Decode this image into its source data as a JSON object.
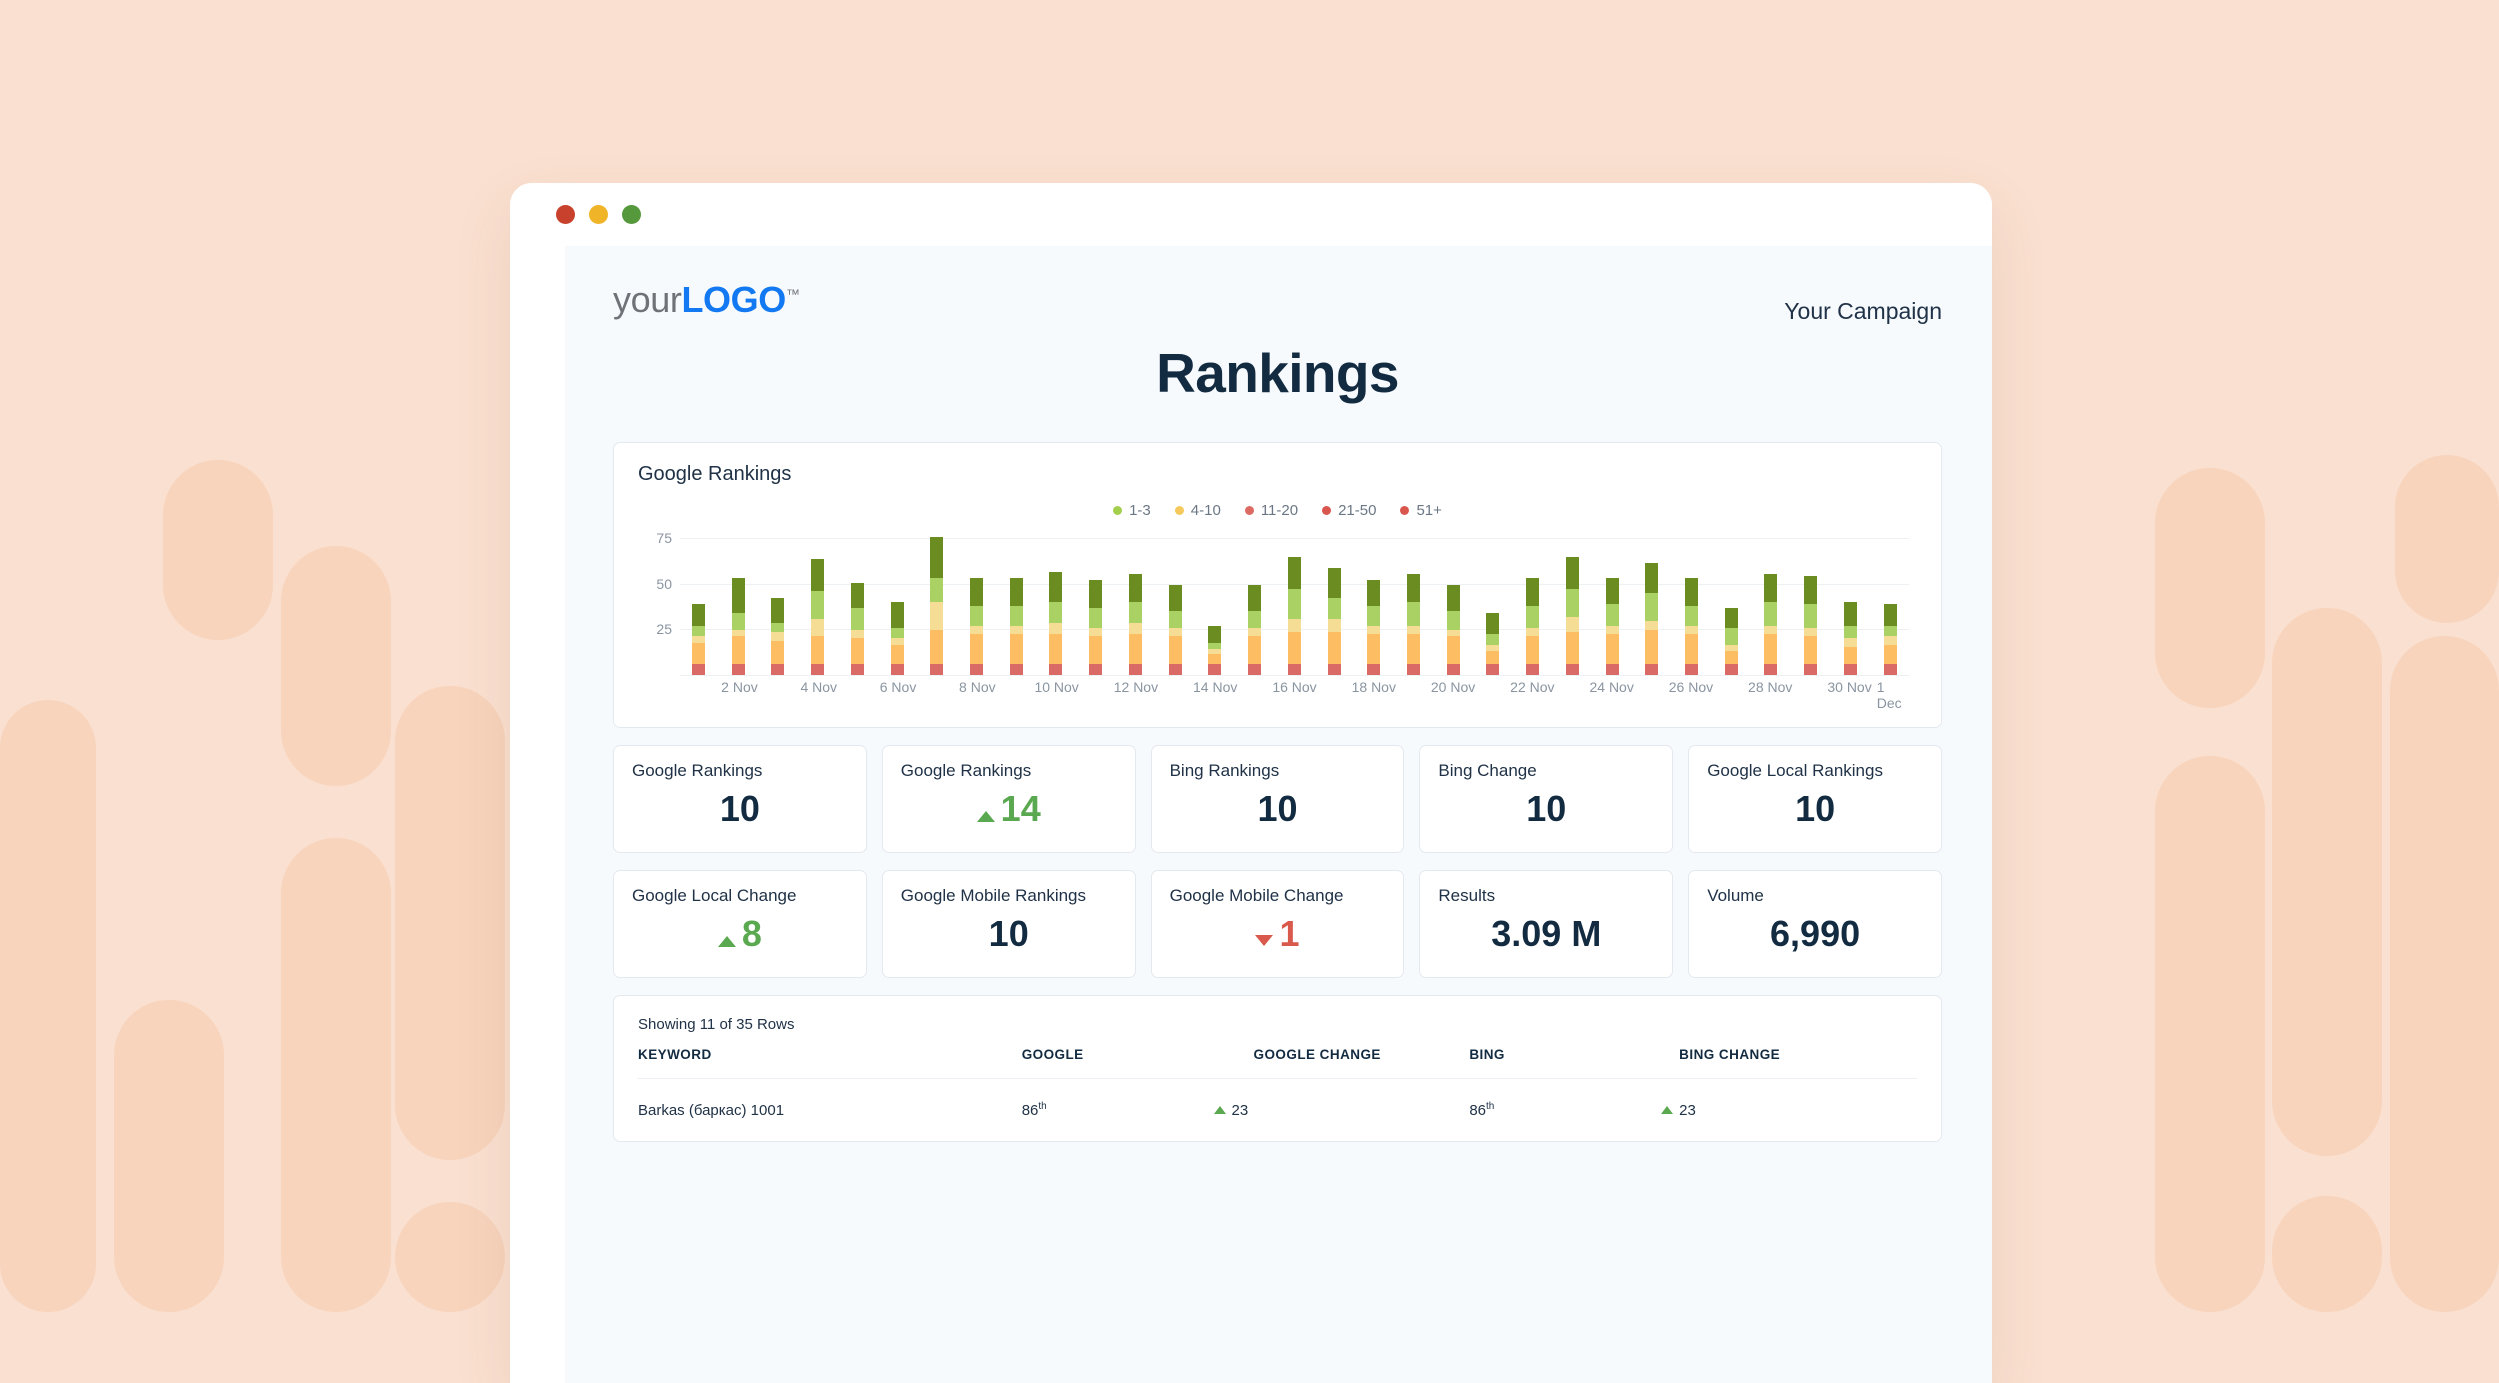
{
  "window": {
    "dots": [
      "close-red",
      "minimize-amber",
      "maximize-green"
    ]
  },
  "header": {
    "logo_prefix": "your",
    "logo_bold": "LOGO",
    "logo_tm": "™",
    "campaign": "Your Campaign",
    "title": "Rankings"
  },
  "chart_card": {
    "title": "Google Rankings"
  },
  "chart_data": {
    "type": "bar",
    "stacked": true,
    "title": "Google Rankings",
    "xlabel": "",
    "ylabel": "",
    "ylim": [
      0,
      80
    ],
    "yticks": [
      25,
      50,
      75
    ],
    "grid": true,
    "legend_position": "top-center",
    "legend": [
      "1-3",
      "4-10",
      "11-20",
      "21-50",
      "51+"
    ],
    "colors": {
      "1-3": "#6b8c21",
      "4-10": "#a9d163",
      "11-20": "#f5dd96",
      "21-50": "#fcbd63",
      "51+": "#da6a65"
    },
    "legend_dot_colors": {
      "1-3": "#a4cf4d",
      "4-10": "#f5c95b",
      "11-20": "#dd6a62",
      "21-50": "#d9564f",
      "51+": "#d9564f"
    },
    "x": [
      "1 Nov",
      "2 Nov",
      "3 Nov",
      "4 Nov",
      "5 Nov",
      "6 Nov",
      "7 Nov",
      "8 Nov",
      "9 Nov",
      "10 Nov",
      "11 Nov",
      "12 Nov",
      "13 Nov",
      "14 Nov",
      "15 Nov",
      "16 Nov",
      "17 Nov",
      "18 Nov",
      "19 Nov",
      "20 Nov",
      "21 Nov",
      "22 Nov",
      "23 Nov",
      "24 Nov",
      "25 Nov",
      "26 Nov",
      "27 Nov",
      "28 Nov",
      "29 Nov",
      "30 Nov",
      "1 Dec"
    ],
    "xticklabels": [
      "2 Nov",
      "4 Nov",
      "6 Nov",
      "8 Nov",
      "10 Nov",
      "12 Nov",
      "14 Nov",
      "16 Nov",
      "18 Nov",
      "20 Nov",
      "22 Nov",
      "24 Nov",
      "26 Nov",
      "28 Nov",
      "30 Nov",
      "1 Dec"
    ],
    "series": [
      {
        "name": "51+",
        "values": [
          5,
          5,
          5,
          5,
          5,
          5,
          5,
          5,
          5,
          5,
          5,
          5,
          5,
          5,
          5,
          5,
          5,
          5,
          5,
          5,
          5,
          5,
          5,
          5,
          5,
          5,
          5,
          5,
          5,
          5,
          5
        ]
      },
      {
        "name": "21-50",
        "values": [
          10,
          13,
          11,
          13,
          12,
          9,
          16,
          14,
          14,
          14,
          13,
          14,
          13,
          5,
          13,
          15,
          15,
          14,
          14,
          13,
          6,
          13,
          15,
          14,
          16,
          14,
          6,
          14,
          13,
          8,
          9
        ]
      },
      {
        "name": "11-20",
        "values": [
          3,
          3,
          4,
          8,
          4,
          3,
          13,
          4,
          4,
          5,
          4,
          5,
          4,
          2,
          4,
          6,
          6,
          4,
          4,
          3,
          3,
          4,
          7,
          4,
          4,
          4,
          3,
          4,
          4,
          4,
          4
        ]
      },
      {
        "name": "4-10",
        "values": [
          5,
          8,
          4,
          13,
          10,
          5,
          11,
          9,
          9,
          10,
          9,
          10,
          8,
          3,
          8,
          14,
          10,
          9,
          11,
          9,
          5,
          10,
          13,
          10,
          13,
          9,
          8,
          11,
          11,
          6,
          5
        ]
      },
      {
        "name": "1-3",
        "values": [
          10,
          16,
          12,
          15,
          12,
          12,
          19,
          13,
          13,
          14,
          13,
          13,
          12,
          8,
          12,
          15,
          14,
          12,
          13,
          12,
          10,
          13,
          15,
          12,
          14,
          13,
          9,
          13,
          13,
          11,
          10
        ]
      }
    ]
  },
  "kpi_rows": [
    [
      {
        "label": "Google Rankings",
        "value": "10",
        "trend": "none"
      },
      {
        "label": "Google Rankings",
        "value": "14",
        "trend": "up"
      },
      {
        "label": "Bing Rankings",
        "value": "10",
        "trend": "none"
      },
      {
        "label": "Bing Change",
        "value": "10",
        "trend": "none"
      },
      {
        "label": "Google Local Rankings",
        "value": "10",
        "trend": "none"
      }
    ],
    [
      {
        "label": "Google Local Change",
        "value": "8",
        "trend": "up"
      },
      {
        "label": "Google Mobile Rankings",
        "value": "10",
        "trend": "none"
      },
      {
        "label": "Google Mobile Change",
        "value": "1",
        "trend": "down"
      },
      {
        "label": "Results",
        "value": "3.09 M",
        "trend": "none"
      },
      {
        "label": "Volume",
        "value": "6,990",
        "trend": "none"
      }
    ]
  ],
  "table": {
    "rows_note": "Showing 11 of 35 Rows",
    "columns": [
      "KEYWORD",
      "GOOGLE",
      "GOOGLE CHANGE",
      "BING",
      "BING CHANGE"
    ],
    "rows": [
      {
        "keyword": "Barkas (баркас) 1001",
        "google": "86",
        "google_sup": "th",
        "google_change": "23",
        "google_change_trend": "up",
        "bing": "86",
        "bing_sup": "th",
        "bing_change": "23",
        "bing_change_trend": "up"
      }
    ]
  },
  "colors": {
    "page_background": "#fae0d0",
    "deco": "#f8d4bd",
    "report_background": "#f7fafd",
    "accent_blue": "#1279f2",
    "text_dark": "#132b41",
    "up_green": "#5aa84f",
    "down_red": "#d9594c"
  }
}
